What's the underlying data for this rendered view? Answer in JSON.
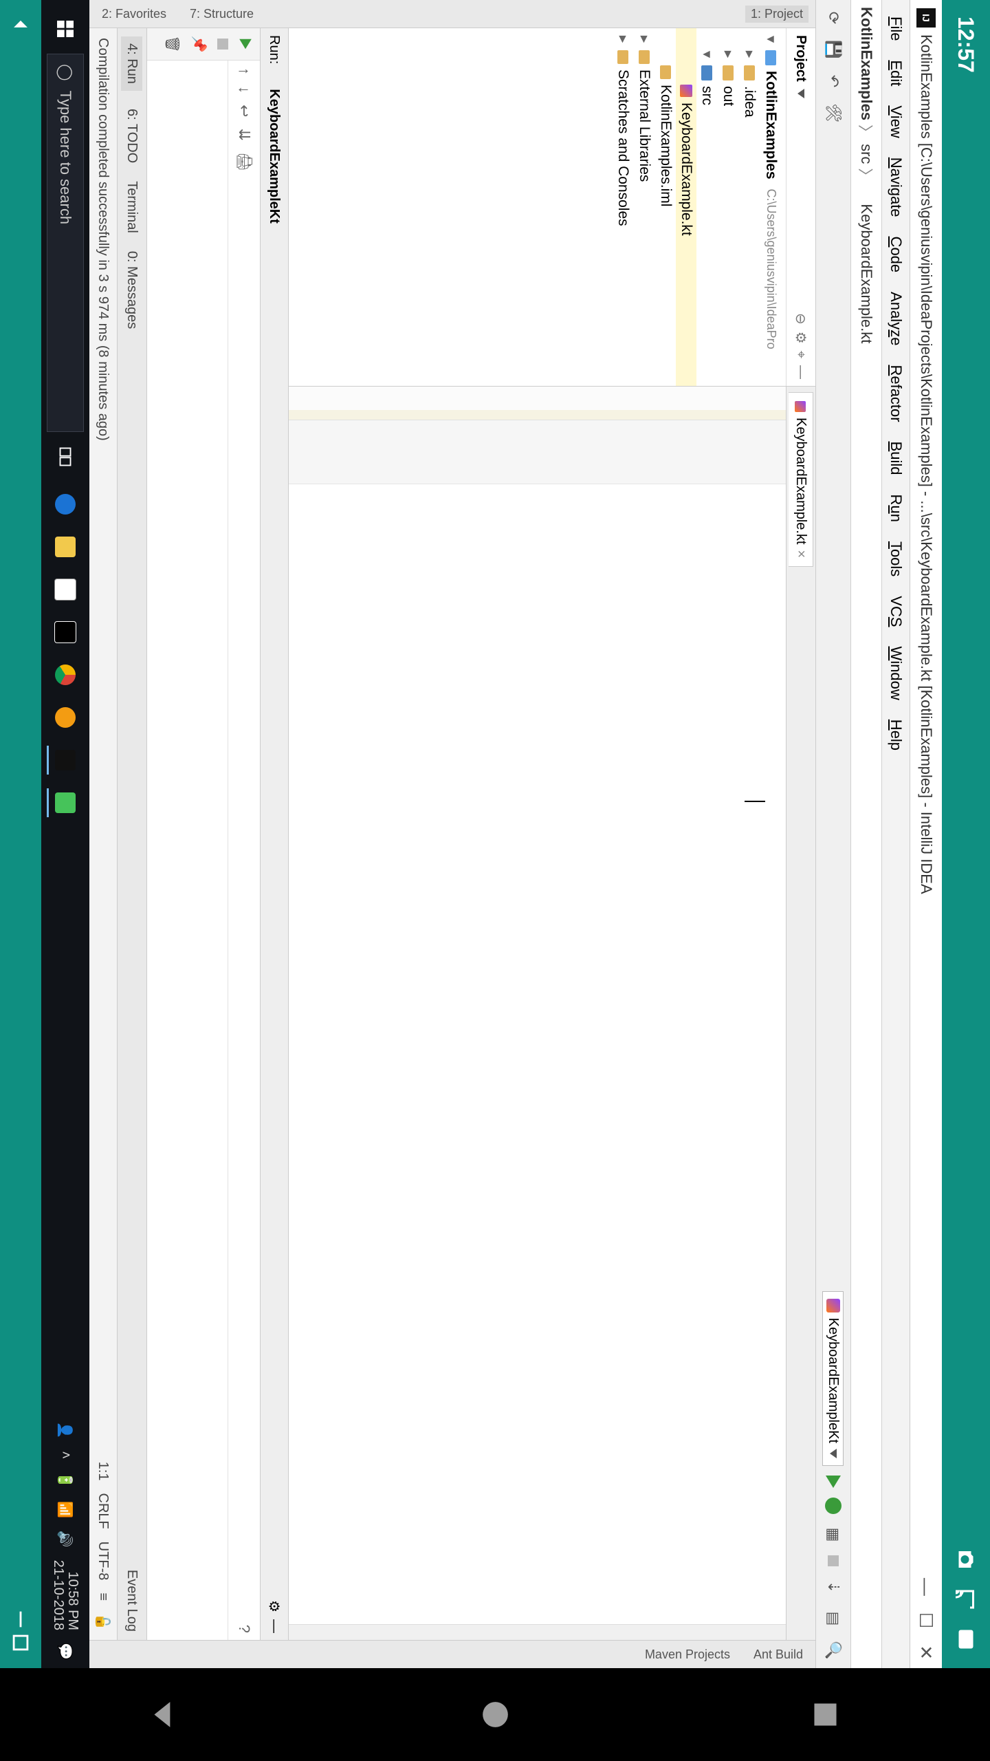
{
  "android": {
    "time": "12:57",
    "nav": {
      "back": "◀",
      "home": "●",
      "recent": "■"
    }
  },
  "titlebar": {
    "text": "KotlinExamples [C:\\Users\\geniusvipin\\IdeaProjects\\KotlinExamples] - ...\\src\\KeyboardExample.kt [KotlinExamples] - IntelliJ IDEA",
    "logo": "IJ"
  },
  "menu": [
    "File",
    "Edit",
    "View",
    "Navigate",
    "Code",
    "Analyze",
    "Refactor",
    "Build",
    "Run",
    "Tools",
    "VCS",
    "Window",
    "Help"
  ],
  "breadcrumb": {
    "root": "KotlinExamples",
    "mid": "src",
    "file": "KeyboardExample.kt"
  },
  "toolbar": {
    "run_config": "KeyboardExampleKt"
  },
  "project_panel": {
    "header": "Project",
    "root": "KotlinExamples",
    "root_path": "C:\\Users\\geniusvipin\\IdeaPro",
    "idea": ".idea",
    "out": "out",
    "src": "src",
    "srcfile": "KeyboardExample.kt",
    "iml": "KotlinExamples.iml",
    "ext": "External Libraries",
    "scratch": "Scratches and Consoles"
  },
  "editor": {
    "tab": "KeyboardExample.kt"
  },
  "left_tabs": {
    "project": "1: Project",
    "structure": "7: Structure",
    "favorites": "2: Favorites"
  },
  "right_tabs": {
    "ant": "Ant Build",
    "maven": "Maven Projects"
  },
  "run": {
    "label": "Run:",
    "title": "KeyboardExampleKt"
  },
  "bottom_tabs": {
    "run": "4: Run",
    "todo": "6: TODO",
    "terminal": "Terminal",
    "messages": "0: Messages",
    "eventlog": "Event Log"
  },
  "statusbar": {
    "msg": "Compilation completed successfully in 3 s 974 ms (8 minutes ago)",
    "pos": "1:1",
    "eol": "CRLF",
    "enc": "UTF-8",
    "indent": "≡"
  },
  "windows": {
    "search_placeholder": "Type here to search",
    "clock_time": "10:58 PM",
    "clock_date": "21-10-2018"
  }
}
